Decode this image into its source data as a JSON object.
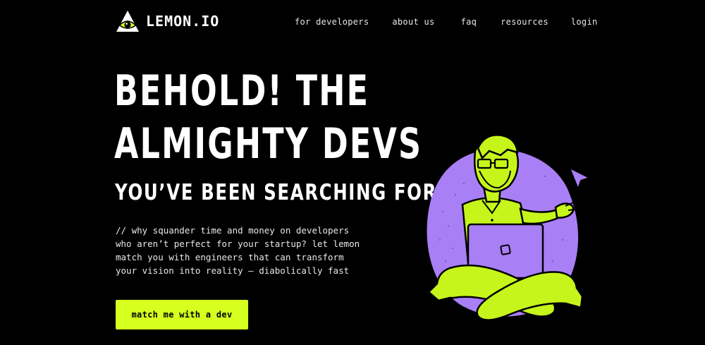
{
  "brand": {
    "name": "LEMON.IO",
    "logo_icon": "eye-triangle-icon",
    "accent_color": "#d7ff1f",
    "purple_color": "#a97ff5"
  },
  "nav": {
    "items": [
      {
        "label": "for developers"
      },
      {
        "label": "about us"
      },
      {
        "label": "faq"
      },
      {
        "label": "resources"
      },
      {
        "label": "login"
      }
    ]
  },
  "hero": {
    "title_line1": "BEHOLD! THE",
    "title_line2": "ALMIGHTY DEVS",
    "subtitle": "YOU’VE BEEN SEARCHING FOR",
    "description_lines": [
      "// why squander time and money on developers",
      "who aren’t perfect for your startup? let lemon",
      "match you with engineers that can transform",
      "your vision into reality — diabolically fast"
    ],
    "cta_label": "match me with a dev"
  },
  "illustration": {
    "subject": "developer-with-laptop-illustration",
    "icons": [
      "mouse-cursor-icon",
      "laptop-icon"
    ]
  }
}
